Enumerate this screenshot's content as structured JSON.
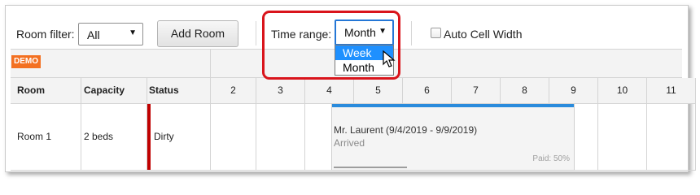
{
  "toolbar": {
    "room_filter_label": "Room filter:",
    "room_filter_value": "All",
    "add_room_label": "Add Room",
    "time_range_label": "Time range:",
    "time_range_value": "Month",
    "auto_cell_width_label": "Auto Cell Width",
    "auto_cell_width_checked": false
  },
  "time_range_dropdown": {
    "options": [
      "Week",
      "Month"
    ],
    "highlighted": "Week"
  },
  "grid": {
    "demo_badge": "DEMO",
    "columns": {
      "room": "Room",
      "capacity": "Capacity",
      "status": "Status"
    },
    "days": [
      "2",
      "3",
      "4",
      "5",
      "6",
      "7",
      "8",
      "9",
      "10",
      "11"
    ],
    "rows": [
      {
        "room": "Room 1",
        "capacity": "2 beds",
        "status": "Dirty",
        "status_color": "#c00000"
      }
    ]
  },
  "reservation": {
    "title": "Mr. Laurent (9/4/2019 - 9/9/2019)",
    "status": "Arrived",
    "paid": "Paid: 50%",
    "paid_fraction": 0.5,
    "bar_color": "#2a8bdc"
  },
  "colors": {
    "highlight": "#d9141b",
    "demo": "#f37021",
    "selection": "#1e90ff"
  }
}
